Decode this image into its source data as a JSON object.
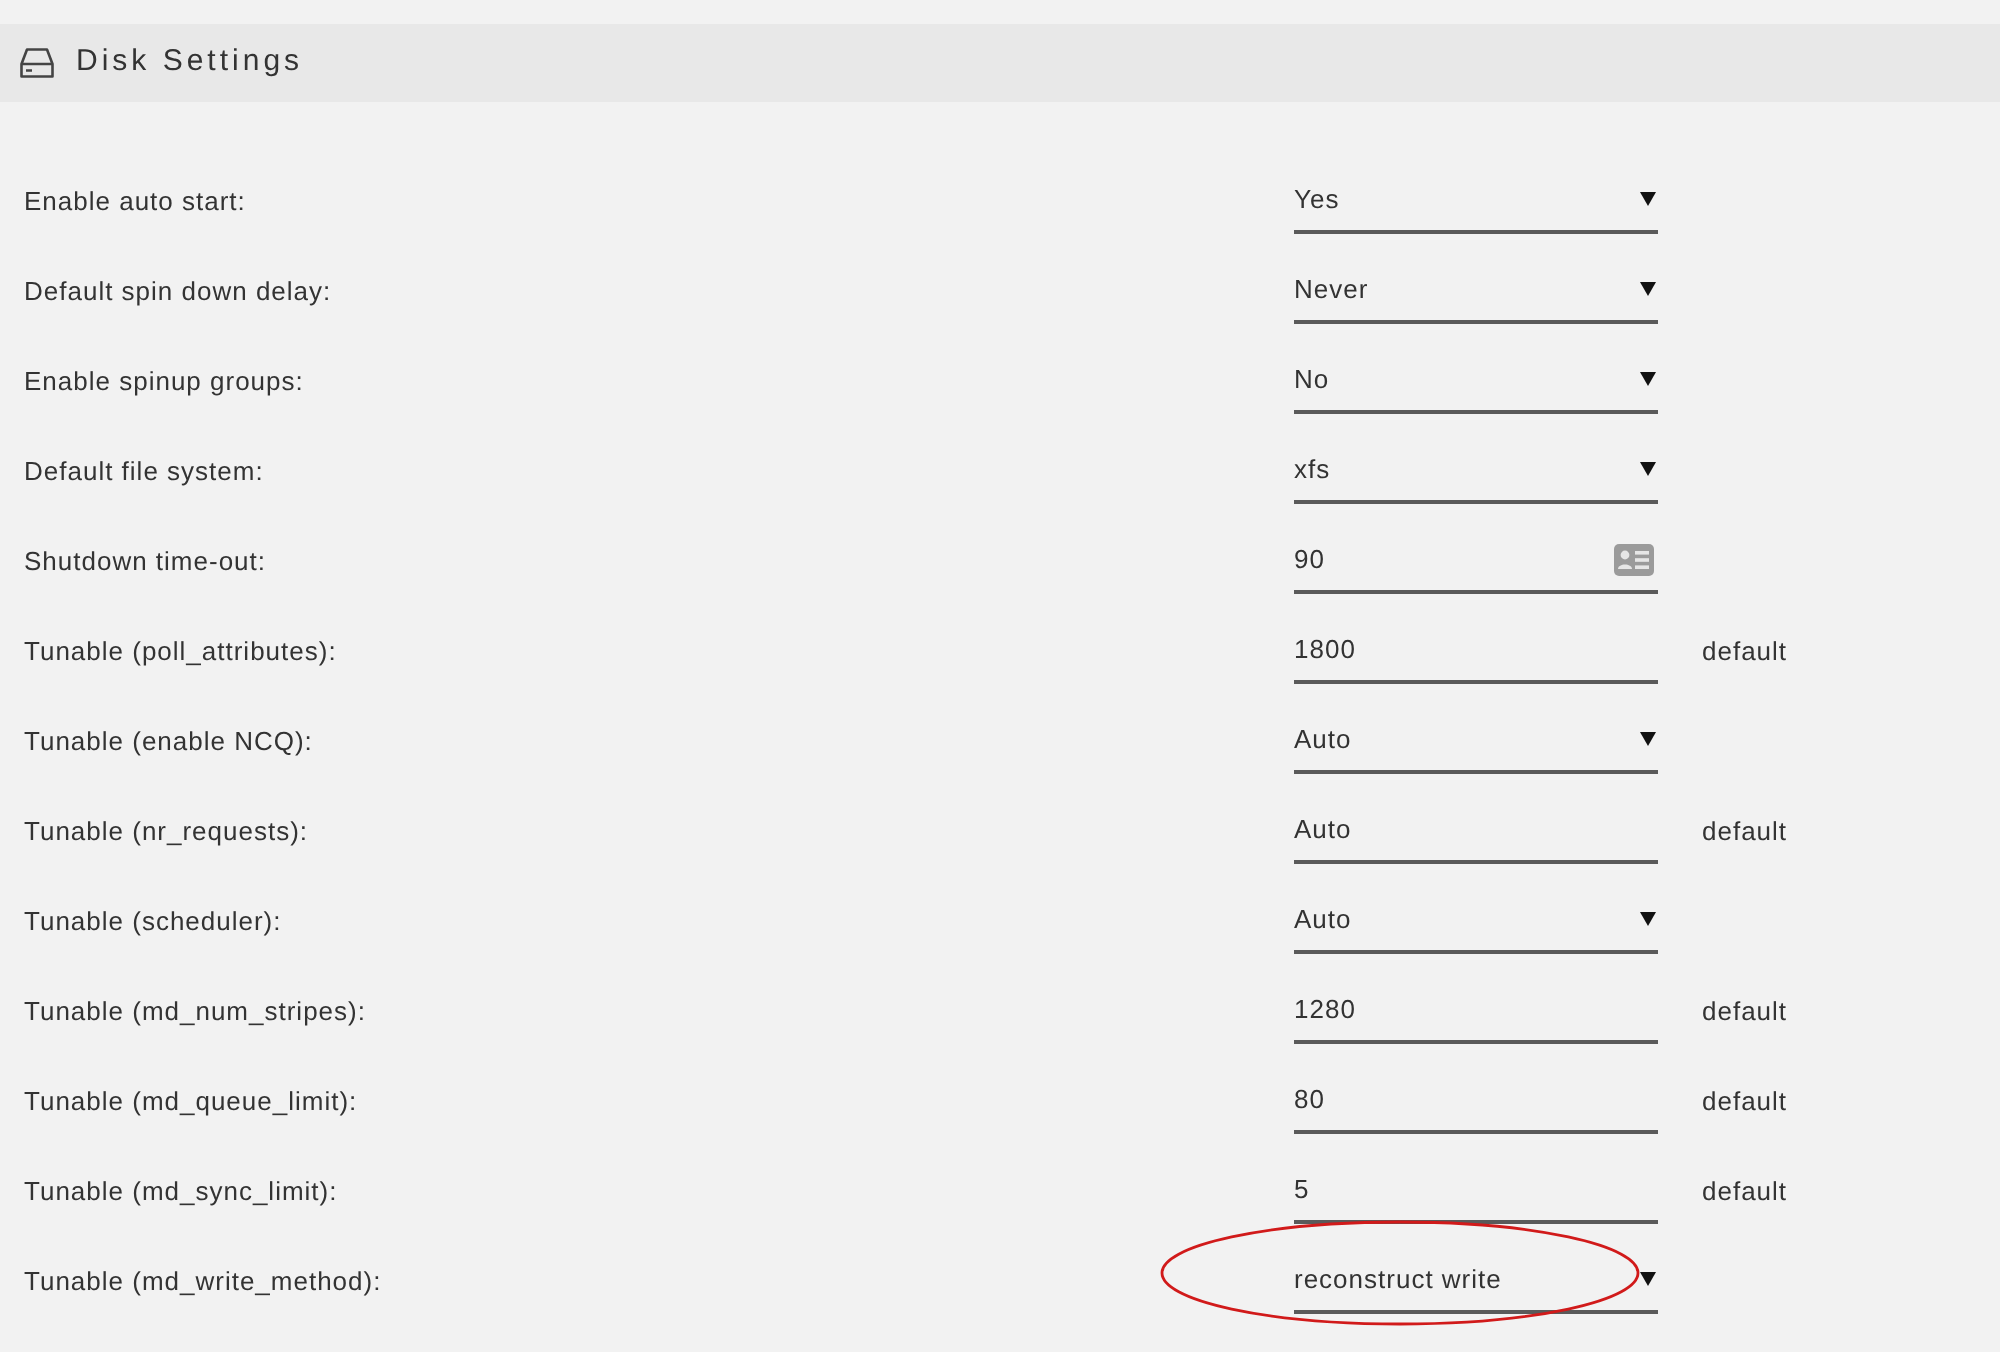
{
  "panel": {
    "title": "Disk Settings"
  },
  "settings": [
    {
      "label": "Enable auto start:",
      "kind": "select",
      "value": "Yes",
      "highlighted": false
    },
    {
      "label": "Default spin down delay:",
      "kind": "select",
      "value": "Never",
      "highlighted": false
    },
    {
      "label": "Enable spinup groups:",
      "kind": "select",
      "value": "No",
      "highlighted": false
    },
    {
      "label": "Default file system:",
      "kind": "select",
      "value": "xfs",
      "highlighted": false
    },
    {
      "label": "Shutdown time-out:",
      "kind": "number",
      "value": "90",
      "highlighted": false
    },
    {
      "label": "Tunable (poll_attributes):",
      "kind": "text",
      "value": "1800",
      "note": "default",
      "highlighted": false
    },
    {
      "label": "Tunable (enable NCQ):",
      "kind": "select",
      "value": "Auto",
      "highlighted": false
    },
    {
      "label": "Tunable (nr_requests):",
      "kind": "text",
      "value": "Auto",
      "note": "default",
      "highlighted": false
    },
    {
      "label": "Tunable (scheduler):",
      "kind": "select",
      "value": "Auto",
      "highlighted": false
    },
    {
      "label": "Tunable (md_num_stripes):",
      "kind": "text",
      "value": "1280",
      "note": "default",
      "highlighted": false
    },
    {
      "label": "Tunable (md_queue_limit):",
      "kind": "text",
      "value": "80",
      "note": "default",
      "highlighted": false
    },
    {
      "label": "Tunable (md_sync_limit):",
      "kind": "text",
      "value": "5",
      "note": "default",
      "highlighted": false
    },
    {
      "label": "Tunable (md_write_method):",
      "kind": "select",
      "value": "reconstruct write",
      "highlighted": true
    }
  ]
}
